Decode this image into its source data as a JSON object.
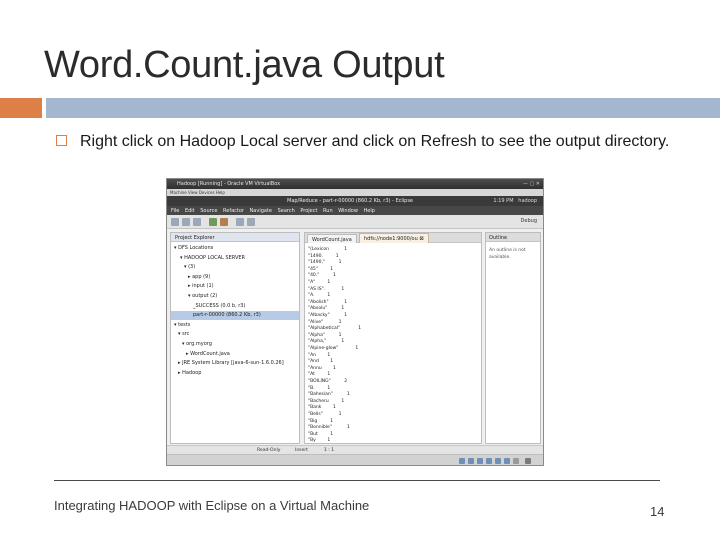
{
  "slide": {
    "title": "Word.Count.java Output",
    "bullet": "Right click on Hadoop Local server and click on Refresh to see the output directory.",
    "footer": "Integrating HADOOP with Eclipse on a Virtual Machine",
    "page_number": "14",
    "colors": {
      "accent_orange": "#dd8047",
      "accent_blue": "#a5b7cf"
    }
  },
  "screenshot": {
    "vm_title": "Hadoop [Running] - Oracle VM VirtualBox",
    "vm_menu": "Machine  View  Devices  Help",
    "eclipse_title": "Map/Reduce - part-r-00000 (860.2 Kb, r3) - Eclipse",
    "clock": "1:19 PM",
    "user": "hadoop",
    "menu_items": "File  Edit  Source  Refactor  Navigate  Search  Project  Run  Window  Help",
    "perspective": "Debug",
    "project_explorer": {
      "tab": "Project Explorer",
      "rows": [
        "▾ DFS Locations",
        "▾ HADOOP LOCAL SERVER",
        "▾ (3)",
        "▸ app (9)",
        "▸ input (1)",
        "▾ output (2)",
        "_SUCCESS (0.0 b, r3)",
        "part-r-00000 (860.2 Kb, r3)",
        "▾ tests",
        "▾ src",
        "▾ org.myorg",
        "▸ WordCount.java",
        "▸ JRE System Library [java-6-sun-1.6.0.26]",
        "▸ Hadoop"
      ],
      "selected_row": 7
    },
    "editor": {
      "tab1": "WordCount.java",
      "tab2": "hdfs://node1:9000/ou ⊠",
      "lines": [
        [
          "\"(Lexicon",
          "1"
        ],
        [
          "\"1490.",
          "1"
        ],
        [
          "\"1490,\"",
          "1"
        ],
        [
          "\"45\"",
          "1"
        ],
        [
          "\"40.\"",
          "1"
        ],
        [
          "\"A\"",
          "1"
        ],
        [
          "\"AS IS\".",
          "1"
        ],
        [
          "\"A.",
          "1"
        ],
        [
          "\"Abolish\"",
          "1"
        ],
        [
          "\"Absolu\"",
          "1"
        ],
        [
          "\"Albacky\"",
          "1"
        ],
        [
          "\"Alive\"",
          "1"
        ],
        [
          "\"Alphabetical\"",
          "1"
        ],
        [
          "\"Alpha\"",
          "1"
        ],
        [
          "\"Alpha,\"",
          "1"
        ],
        [
          "\"Alpine-glow\"",
          "1"
        ],
        [
          "\"An",
          "1"
        ],
        [
          "\"And",
          "1"
        ],
        [
          "\"Annu",
          "1"
        ],
        [
          "\"At",
          "1"
        ],
        [
          "\"BOILING\"",
          "2"
        ],
        [
          "\"B.",
          "1"
        ],
        [
          "\"Bahesian\"",
          "1"
        ],
        [
          "\"Bacheru",
          "1"
        ],
        [
          "\"Bank",
          "1"
        ],
        [
          "\"Bells\"",
          "1"
        ],
        [
          "\"Big",
          "1"
        ],
        [
          "\"Bonnible\"",
          "1"
        ],
        [
          "\"But",
          "1"
        ],
        [
          "\"By",
          "1"
        ]
      ]
    },
    "outline": {
      "tab": "Outline",
      "text": "An outline is not available."
    },
    "status": {
      "left": "Read-Only",
      "middle": "Insert",
      "right": "1 : 1"
    }
  }
}
